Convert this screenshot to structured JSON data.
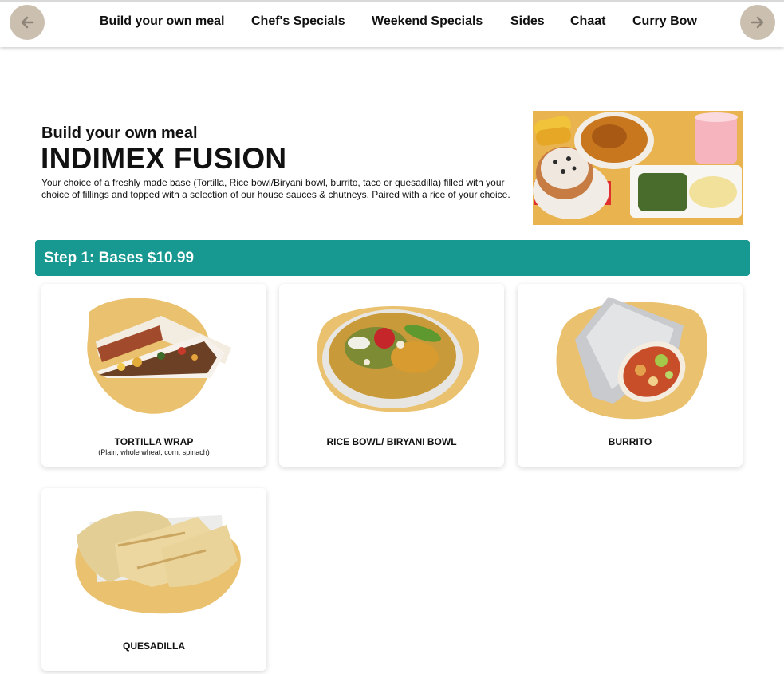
{
  "nav": {
    "prev_icon": "arrow-left-icon",
    "next_icon": "arrow-right-icon",
    "tabs": [
      {
        "label": "Build your own meal"
      },
      {
        "label": "Chef's Specials"
      },
      {
        "label": "Weekend Specials"
      },
      {
        "label": "Sides"
      },
      {
        "label": "Chaat"
      },
      {
        "label": "Curry Bow"
      }
    ]
  },
  "hero": {
    "subtitle": "Build your own meal",
    "title": "INDIMEX FUSION",
    "description": "Your choice of a freshly made base (Tortilla, Rice bowl/Biryani bowl, burrito, taco or quesadilla) filled with your choice of fillings and topped with a selection of our house sauces & chutneys. Paired with a rice of your choice."
  },
  "step": {
    "title": "Step 1: Bases $10.99"
  },
  "bases": [
    {
      "name": "TORTILLA WRAP",
      "sub": "(Plain, whole wheat, corn, spinach)"
    },
    {
      "name": "RICE BOWL/ BIRYANI BOWL",
      "sub": ""
    },
    {
      "name": "BURRITO",
      "sub": ""
    },
    {
      "name": "QUESADILLA",
      "sub": ""
    }
  ],
  "colors": {
    "accent": "#179890",
    "nav_arrow_bg": "#cbbfb0",
    "card_blob": "#eac16e"
  }
}
